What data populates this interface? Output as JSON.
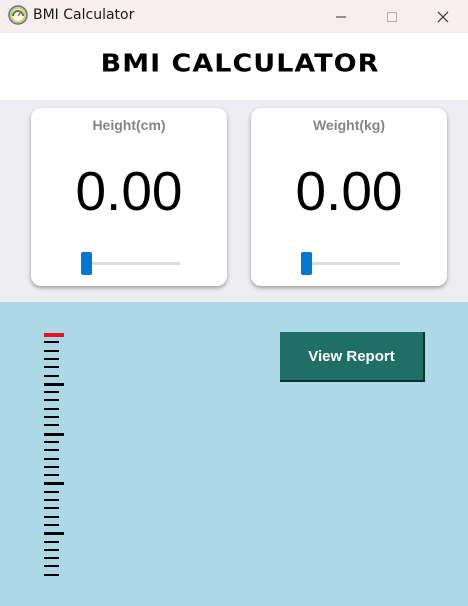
{
  "window": {
    "title": "BMI Calculator",
    "icon": "bmi-app-icon"
  },
  "header": {
    "title": "BMI CALCULATOR"
  },
  "height_card": {
    "label": "Height(cm)",
    "value": "0.00",
    "slider_value": 0
  },
  "weight_card": {
    "label": "Weight(kg)",
    "value": "0.00",
    "slider_value": 0
  },
  "actions": {
    "view_report_label": "View Report"
  },
  "colors": {
    "titlebar_bg": "#f9eeee",
    "input_area_bg": "#eeeef2",
    "result_area_bg": "#add8e6",
    "slider_accent": "#0078d4",
    "button_bg": "#1f6f66",
    "scale_marker": "#e81123"
  }
}
